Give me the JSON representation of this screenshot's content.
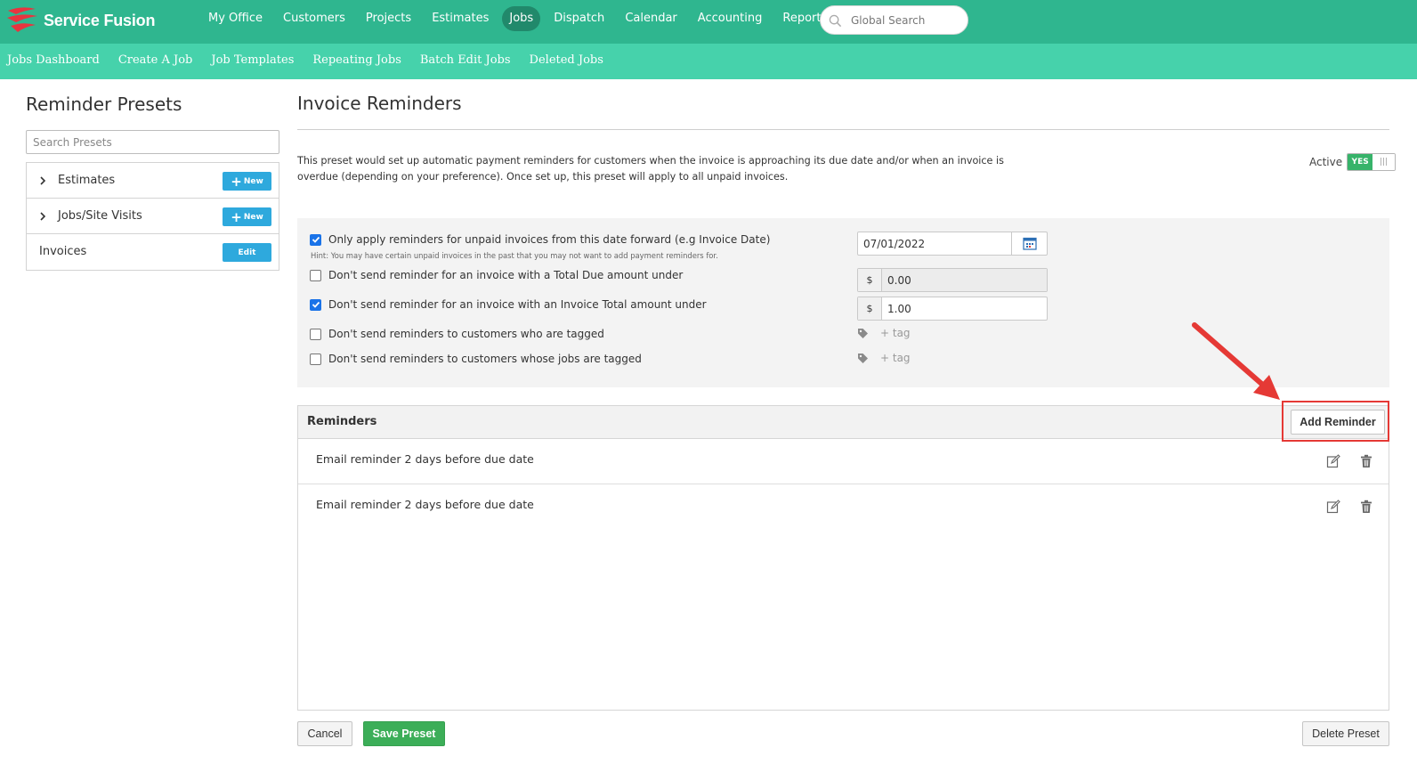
{
  "brand": {
    "name": "Service Fusion",
    "logo_color": "#e8343f",
    "nav_color": "#2fb68f",
    "subnav_color": "#46d2ab"
  },
  "main_nav": {
    "items": [
      "My Office",
      "Customers",
      "Projects",
      "Estimates",
      "Jobs",
      "Dispatch",
      "Calendar",
      "Accounting",
      "Reports"
    ],
    "active": "Jobs"
  },
  "global_search": {
    "placeholder": "Global Search"
  },
  "sub_nav": {
    "items": [
      "Jobs Dashboard",
      "Create A Job",
      "Job Templates",
      "Repeating Jobs",
      "Batch Edit Jobs",
      "Deleted Jobs"
    ]
  },
  "sidebar": {
    "title": "Reminder Presets",
    "search_placeholder": "Search Presets",
    "presets": [
      {
        "label": "Estimates",
        "expandable": true,
        "button": "New"
      },
      {
        "label": "Jobs/Site Visits",
        "expandable": true,
        "button": "New"
      },
      {
        "label": "Invoices",
        "expandable": false,
        "button": "Edit"
      }
    ]
  },
  "main": {
    "title": "Invoice Reminders",
    "description": "This preset would set up automatic payment reminders for customers when the invoice is approaching its due date and/or when an invoice is overdue (depending on your preference). Once set up, this preset will apply to all unpaid invoices.",
    "active": {
      "label": "Active",
      "value": "YES"
    },
    "settings": {
      "date_forward": {
        "label": "Only apply reminders for unpaid invoices from this date forward (e.g Invoice Date)",
        "checked": true,
        "hint": "Hint: You may have certain unpaid invoices in the past that you may not want to add payment reminders for.",
        "value": "07/01/2022"
      },
      "total_due": {
        "label": "Don't send reminder for an invoice with a Total Due amount under",
        "checked": false,
        "currency": "$",
        "value": "0.00"
      },
      "invoice_total": {
        "label": "Don't send reminder for an invoice with an Invoice Total amount under",
        "checked": true,
        "currency": "$",
        "value": "1.00"
      },
      "customer_tagged": {
        "label": "Don't send reminders to customers who are tagged",
        "checked": false,
        "tag_placeholder": "+ tag"
      },
      "jobs_tagged": {
        "label": "Don't send reminders to customers whose jobs are tagged",
        "checked": false,
        "tag_placeholder": "+ tag"
      }
    },
    "reminders": {
      "title": "Reminders",
      "add_button": "Add Reminder",
      "items": [
        "Email reminder 2 days before due date",
        "Email reminder 2 days before due date"
      ]
    },
    "footer": {
      "cancel": "Cancel",
      "save": "Save Preset",
      "delete": "Delete Preset"
    }
  },
  "annotation": {
    "color": "#e53935"
  }
}
